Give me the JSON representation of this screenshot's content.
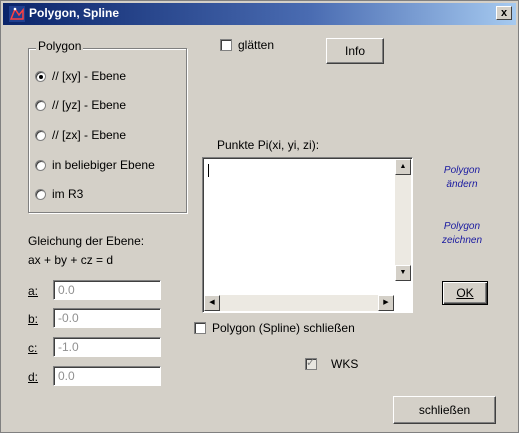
{
  "window": {
    "title": "Polygon, Spline",
    "close_glyph": "x"
  },
  "polygon_group": {
    "legend": "Polygon",
    "options": [
      {
        "label": "// [xy] - Ebene",
        "selected": true
      },
      {
        "label": "// [yz] - Ebene",
        "selected": false
      },
      {
        "label": "// [zx] - Ebene",
        "selected": false
      },
      {
        "label": "in beliebiger Ebene",
        "selected": false
      },
      {
        "label": "im R3",
        "selected": false
      }
    ]
  },
  "smooth": {
    "label": "glätten",
    "checked": false
  },
  "info_button": "Info",
  "points": {
    "label": "Punkte Pi(xi, yi, zi):",
    "value": ""
  },
  "side_buttons": {
    "change": {
      "line1": "Polygon",
      "line2": "ändern"
    },
    "draw": {
      "line1": "Polygon",
      "line2": "zeichnen"
    }
  },
  "plane": {
    "heading": "Gleichung der Ebene:",
    "equation": "ax + by + cz = d",
    "fields": [
      {
        "label": "a:",
        "value": "0.0"
      },
      {
        "label": "b:",
        "value": "-0.0"
      },
      {
        "label": "c:",
        "value": "-1.0"
      },
      {
        "label": "d:",
        "value": "0.0"
      }
    ]
  },
  "close_polygon": {
    "label": "Polygon (Spline) schließen",
    "checked": false
  },
  "wks": {
    "label": "WKS",
    "checked": true,
    "enabled": false
  },
  "ok_button": "OK",
  "close_button": "schließen",
  "scroll_icons": {
    "up": "▲",
    "down": "▼",
    "left": "◀",
    "right": "▶"
  },
  "colors": {
    "title_bar_start": "#0a246a",
    "dialog_face": "#d4d0c8",
    "link_text": "#1a1aa0"
  }
}
